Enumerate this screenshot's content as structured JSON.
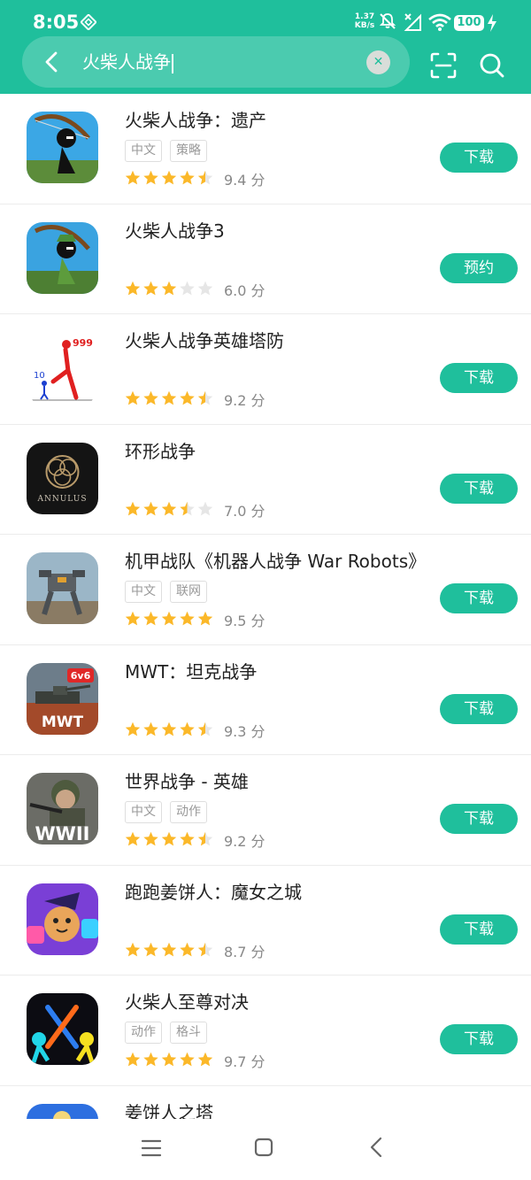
{
  "status_bar": {
    "time": "8:05",
    "net_speed_value": "1.37",
    "net_speed_unit": "KB/s",
    "battery": "100"
  },
  "search": {
    "query": "火柴人战争",
    "icons": [
      "back-icon",
      "clear-icon",
      "scan-icon",
      "search-icon"
    ]
  },
  "colors": {
    "accent": "#1fbf9c",
    "star": "#fbb829",
    "star_empty": "#e6e6e6"
  },
  "results": [
    {
      "title": "火柴人战争：遗产",
      "tags": [
        "中文",
        "策略"
      ],
      "rating": 4.5,
      "score": "9.4 分",
      "action": "下载"
    },
    {
      "title": "火柴人战争3",
      "tags": [],
      "rating": 3,
      "score": "6.0 分",
      "action": "预约"
    },
    {
      "title": "火柴人战争英雄塔防",
      "tags": [],
      "rating": 4.5,
      "score": "9.2 分",
      "action": "下载"
    },
    {
      "title": "环形战争",
      "tags": [],
      "rating": 3.5,
      "score": "7.0 分",
      "action": "下载"
    },
    {
      "title": "机甲战队《机器人战争 War Robots》",
      "tags": [
        "中文",
        "联网"
      ],
      "rating": 5,
      "score": "9.5 分",
      "action": "下载"
    },
    {
      "title": "MWT：坦克战争",
      "tags": [],
      "rating": 4.5,
      "score": "9.3 分",
      "action": "下载"
    },
    {
      "title": "世界战争 - 英雄",
      "tags": [
        "中文",
        "动作"
      ],
      "rating": 4.5,
      "score": "9.2 分",
      "action": "下载"
    },
    {
      "title": "跑跑姜饼人：魔女之城",
      "tags": [],
      "rating": 4.5,
      "score": "8.7 分",
      "action": "下载"
    },
    {
      "title": "火柴人至尊对决",
      "tags": [
        "动作",
        "格斗"
      ],
      "rating": 5,
      "score": "9.7 分",
      "action": "下载"
    },
    {
      "title": "姜饼人之塔",
      "tags": [],
      "rating": null,
      "score": "",
      "action": ""
    }
  ],
  "icon_texts": {
    "stick_999": "999",
    "stick_10": "10",
    "annulus": "ANNULUS",
    "mwt_badge": "6v6",
    "mwt_logo": "MWT",
    "wwii": "WWII"
  },
  "nav": {
    "icons": [
      "menu-icon",
      "home-icon",
      "back-icon"
    ]
  }
}
